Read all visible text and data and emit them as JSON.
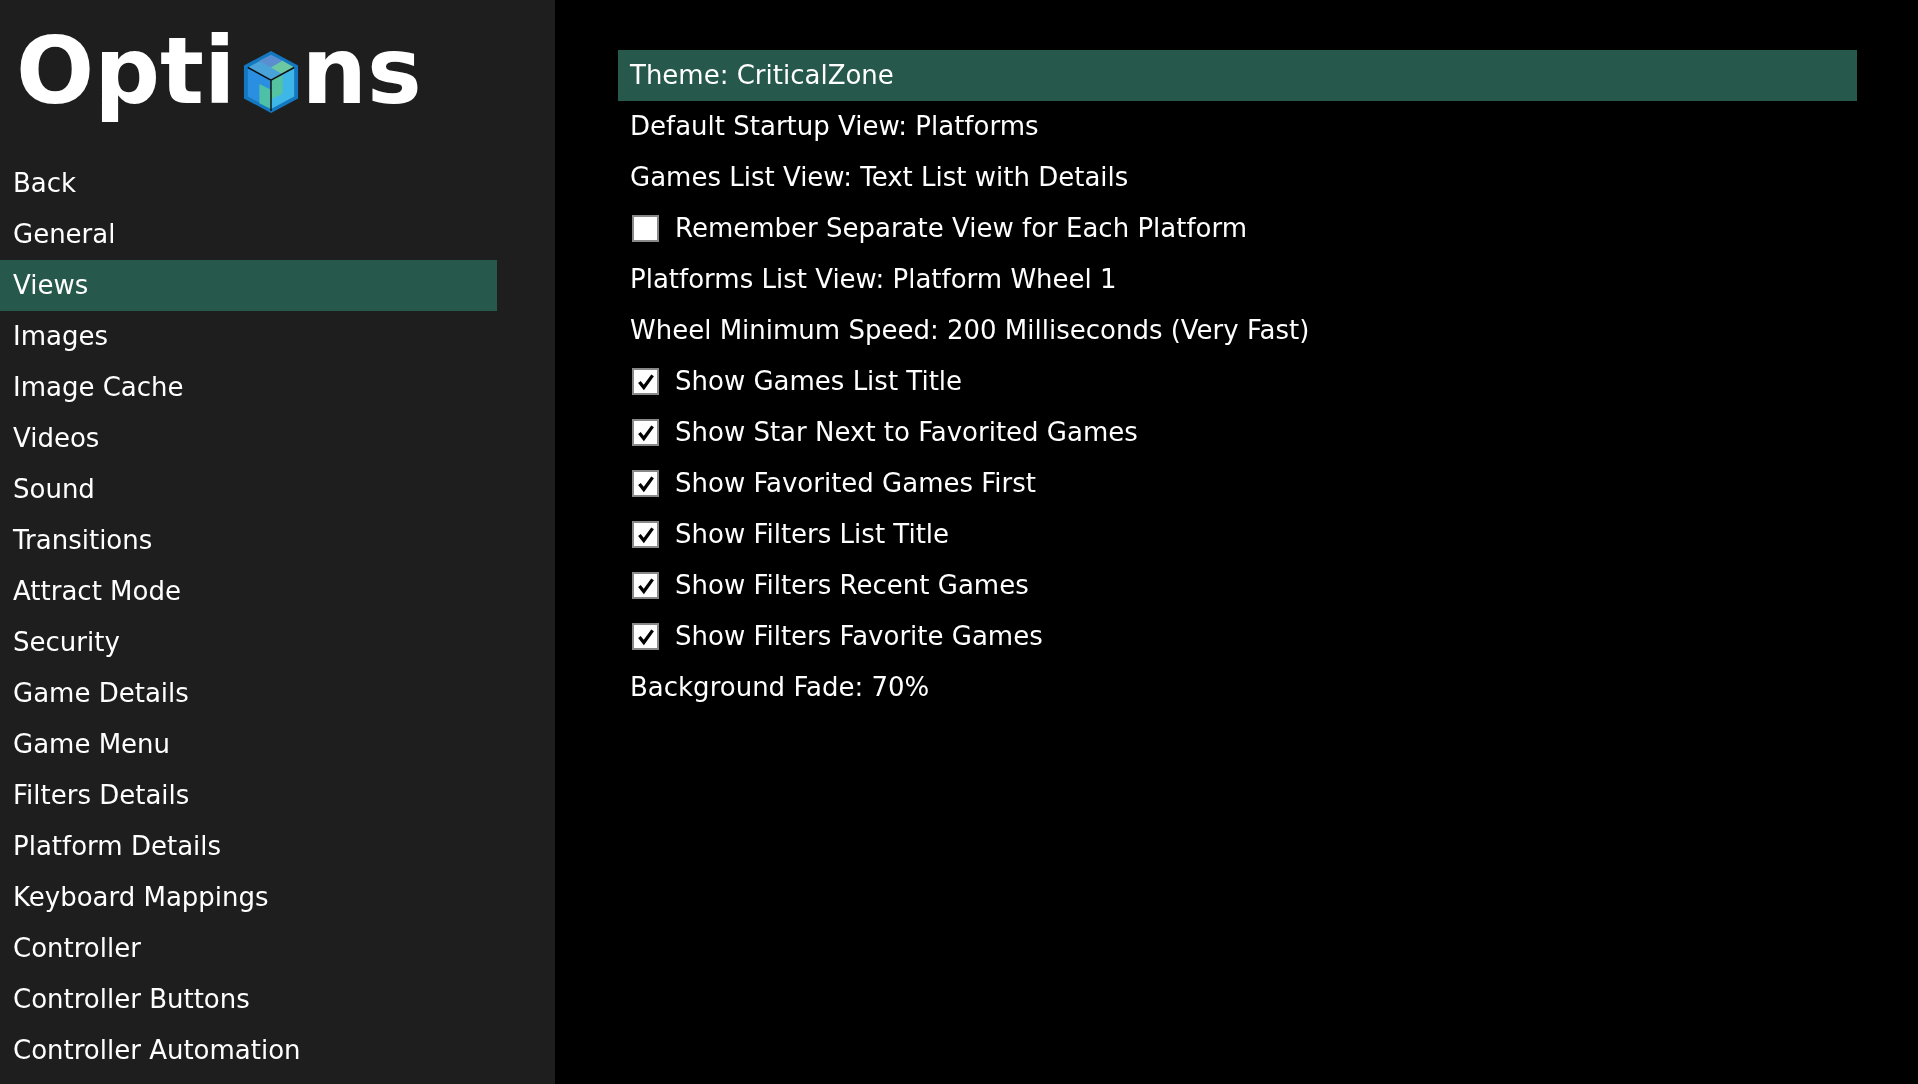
{
  "logo": {
    "title_start": "Opti",
    "title_end": "ns"
  },
  "sidebar": {
    "items": [
      {
        "label": "Back",
        "selected": false
      },
      {
        "label": "General",
        "selected": false
      },
      {
        "label": "Views",
        "selected": true
      },
      {
        "label": "Images",
        "selected": false
      },
      {
        "label": "Image Cache",
        "selected": false
      },
      {
        "label": "Videos",
        "selected": false
      },
      {
        "label": "Sound",
        "selected": false
      },
      {
        "label": "Transitions",
        "selected": false
      },
      {
        "label": "Attract Mode",
        "selected": false
      },
      {
        "label": "Security",
        "selected": false
      },
      {
        "label": "Game Details",
        "selected": false
      },
      {
        "label": "Game Menu",
        "selected": false
      },
      {
        "label": "Filters Details",
        "selected": false
      },
      {
        "label": "Platform Details",
        "selected": false
      },
      {
        "label": "Keyboard Mappings",
        "selected": false
      },
      {
        "label": "Controller",
        "selected": false
      },
      {
        "label": "Controller Buttons",
        "selected": false
      },
      {
        "label": "Controller Automation",
        "selected": false
      }
    ]
  },
  "settings": [
    {
      "kind": "value",
      "label": "Theme: CriticalZone",
      "selected": true
    },
    {
      "kind": "value",
      "label": "Default Startup View: Platforms",
      "selected": false
    },
    {
      "kind": "value",
      "label": "Games List View: Text List with Details",
      "selected": false
    },
    {
      "kind": "checkbox",
      "label": "Remember Separate View for Each Platform",
      "checked": false,
      "selected": false
    },
    {
      "kind": "value",
      "label": "Platforms List View: Platform Wheel 1",
      "selected": false
    },
    {
      "kind": "value",
      "label": "Wheel Minimum Speed: 200 Milliseconds (Very Fast)",
      "selected": false
    },
    {
      "kind": "checkbox",
      "label": "Show Games List Title",
      "checked": true,
      "selected": false
    },
    {
      "kind": "checkbox",
      "label": "Show Star Next to Favorited Games",
      "checked": true,
      "selected": false
    },
    {
      "kind": "checkbox",
      "label": "Show Favorited Games First",
      "checked": true,
      "selected": false
    },
    {
      "kind": "checkbox",
      "label": "Show Filters List Title",
      "checked": true,
      "selected": false
    },
    {
      "kind": "checkbox",
      "label": "Show Filters Recent Games",
      "checked": true,
      "selected": false
    },
    {
      "kind": "checkbox",
      "label": "Show Filters Favorite Games",
      "checked": true,
      "selected": false
    },
    {
      "kind": "value",
      "label": "Background Fade: 70%",
      "selected": false
    }
  ]
}
